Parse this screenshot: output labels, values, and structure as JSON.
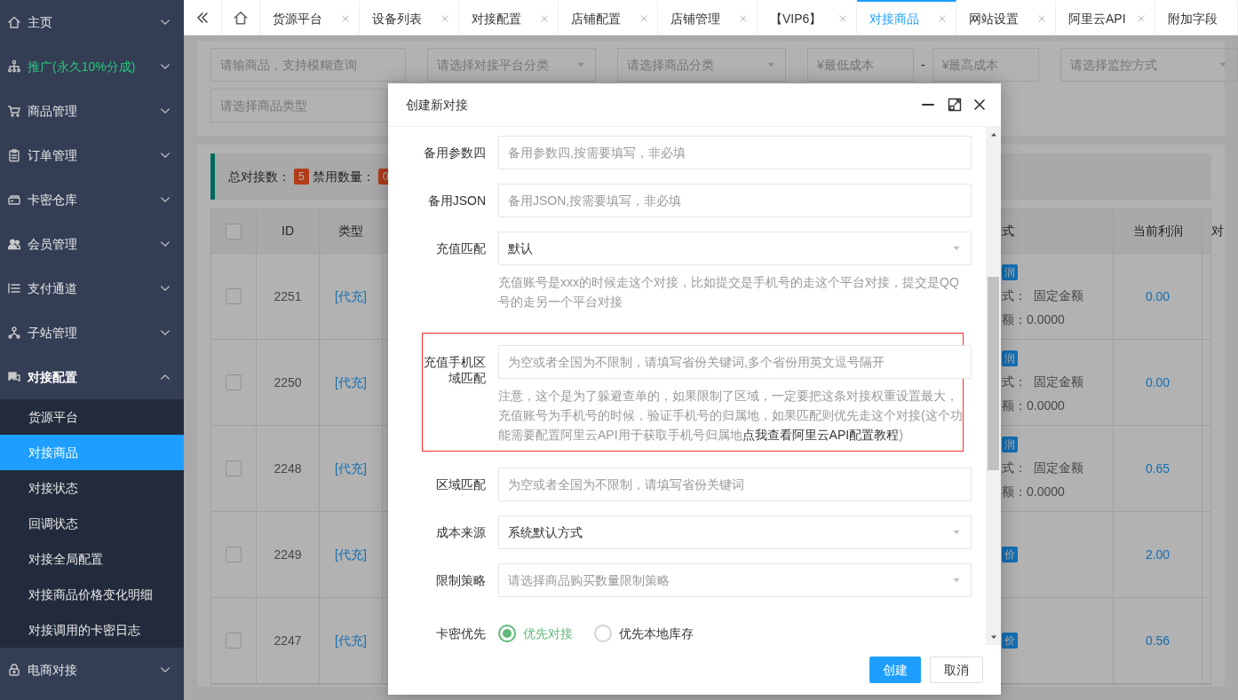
{
  "sidebar": {
    "items": [
      {
        "label": "主页",
        "expanded": false,
        "promo": false
      },
      {
        "label": "推广(永久10%分成)",
        "expanded": false,
        "promo": true
      },
      {
        "label": "商品管理",
        "expanded": false,
        "promo": false
      },
      {
        "label": "订单管理",
        "expanded": false,
        "promo": false
      },
      {
        "label": "卡密仓库",
        "expanded": false,
        "promo": false
      },
      {
        "label": "会员管理",
        "expanded": false,
        "promo": false
      },
      {
        "label": "支付通道",
        "expanded": false,
        "promo": false
      },
      {
        "label": "子站管理",
        "expanded": false,
        "promo": false
      },
      {
        "label": "对接配置",
        "expanded": true,
        "promo": false,
        "children": [
          {
            "label": "货源平台",
            "selected": false
          },
          {
            "label": "对接商品",
            "selected": true
          },
          {
            "label": "对接状态",
            "selected": false
          },
          {
            "label": "回调状态",
            "selected": false
          },
          {
            "label": "对接全局配置",
            "selected": false
          },
          {
            "label": "对接商品价格变化明细",
            "selected": false
          },
          {
            "label": "对接调用的卡密日志",
            "selected": false
          }
        ]
      },
      {
        "label": "电商对接",
        "expanded": false,
        "promo": false
      }
    ]
  },
  "tabs": [
    {
      "label": "货源平台",
      "selected": false,
      "closable": true
    },
    {
      "label": "设备列表",
      "selected": false,
      "closable": true
    },
    {
      "label": "对接配置",
      "selected": false,
      "closable": true
    },
    {
      "label": "店铺配置",
      "selected": false,
      "closable": true
    },
    {
      "label": "店铺管理",
      "selected": false,
      "closable": true
    },
    {
      "label": "【VIP6】",
      "selected": false,
      "closable": true
    },
    {
      "label": "对接商品",
      "selected": true,
      "closable": true
    },
    {
      "label": "网站设置",
      "selected": false,
      "closable": true
    },
    {
      "label": "阿里云API",
      "selected": false,
      "closable": true
    },
    {
      "label": "附加字段",
      "selected": false,
      "closable": false
    }
  ],
  "filters": {
    "keyword": {
      "placeholder": "请输商品，支持模糊查询"
    },
    "platform": {
      "placeholder": "请选择对接平台分类"
    },
    "category": {
      "placeholder": "请选择商品分类"
    },
    "min_cost": {
      "placeholder": "¥最低成本"
    },
    "separator": "-",
    "max_cost": {
      "placeholder": "¥最高成本"
    },
    "monitor": {
      "placeholder": "请选择监控方式"
    },
    "goods_type": {
      "placeholder": "请选择商品类型"
    }
  },
  "stats": {
    "total_label": "总对接数：",
    "total": "5",
    "disabled_label": "禁用数量：",
    "disabled": "0"
  },
  "table": {
    "all_checked": false,
    "columns": [
      "ID",
      "类型",
      "式",
      "当前利润",
      "对"
    ],
    "rows": [
      {
        "checked": false,
        "id": "2251",
        "type": "[代充]",
        "badge": "润",
        "lines": [
          "式：  固定金额",
          "额：0.0000"
        ],
        "profit": "0.00"
      },
      {
        "checked": false,
        "id": "2250",
        "type": "[代充]",
        "badge": "润",
        "lines": [
          "式：  固定金额",
          "额：0.0000"
        ],
        "profit": "0.00"
      },
      {
        "checked": false,
        "id": "2248",
        "type": "[代充]",
        "badge": "润",
        "lines": [
          "式：  固定金额",
          "额：0.0000"
        ],
        "profit": "0.65"
      },
      {
        "checked": false,
        "id": "2249",
        "type": "[代充]",
        "badge": "价",
        "lines": [],
        "profit": "2.00"
      },
      {
        "checked": false,
        "id": "2247",
        "type": "[代充]",
        "badge": "价",
        "lines": [],
        "profit": "0.56"
      }
    ]
  },
  "dialog": {
    "title": "创建新对接",
    "fields": [
      {
        "kind": "input",
        "label": "备用参数四",
        "placeholder": "备用参数四,按需要填写，非必填",
        "highlighted": false
      },
      {
        "kind": "input",
        "label": "备用JSON",
        "placeholder": "备用JSON,按需要填写，非必填",
        "highlighted": false
      },
      {
        "kind": "select",
        "label": "充值匹配",
        "value": "默认",
        "help": "充值账号是xxx的时候走这个对接，比如提交是手机号的走这个平台对接，提交是QQ号的走另一个平台对接",
        "highlighted": false
      },
      {
        "kind": "input",
        "label": "充值手机区域匹配",
        "placeholder": "为空或者全国为不限制，请填写省份关键词,多个省份用英文逗号隔开",
        "help": "注意，这个是为了躲避查单的，如果限制了区域，一定要把这条对接权重设置最大，充值账号为手机号的时候，验证手机号的归属地，如果匹配则优先走这个对接(这个功能需要配置阿里云API用于获取手机号归属地",
        "help_link": "点我查看阿里云API配置教程",
        "help_after": ")",
        "highlighted": true
      },
      {
        "kind": "input",
        "label": "区域匹配",
        "placeholder": "为空或者全国为不限制，请填写省份关键词",
        "highlighted": false
      },
      {
        "kind": "select",
        "label": "成本来源",
        "value": "系统默认方式",
        "highlighted": false
      },
      {
        "kind": "select",
        "label": "限制策略",
        "placeholder": "请选择商品购买数量限制策略",
        "highlighted": false
      },
      {
        "kind": "radio",
        "label": "卡密优先",
        "options": [
          {
            "label": "优先对接",
            "selected": true
          },
          {
            "label": "优先本地库存",
            "selected": false
          }
        ],
        "highlighted": false
      }
    ],
    "buttons": [
      {
        "label": "创建",
        "primary": true
      },
      {
        "label": "取消",
        "primary": false
      }
    ]
  }
}
